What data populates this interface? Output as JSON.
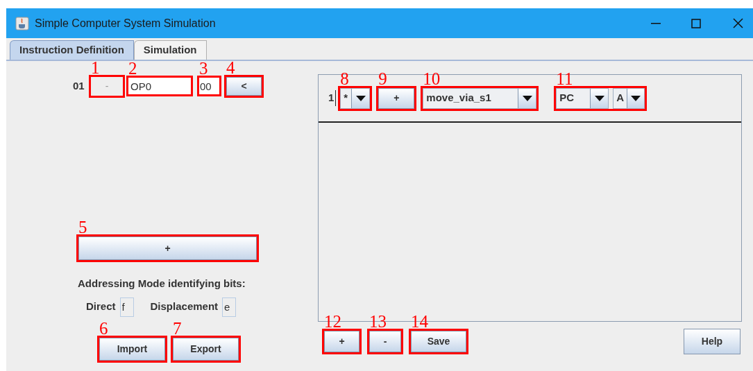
{
  "window": {
    "title": "Simple Computer System Simulation"
  },
  "tabs": [
    {
      "label": "Instruction Definition",
      "selected": true
    },
    {
      "label": "Simulation",
      "selected": false
    }
  ],
  "instruction_row": {
    "number": "01",
    "remove_button": {
      "label": "-",
      "disabled": true,
      "callout": "1"
    },
    "name_field": {
      "value": "OP0",
      "callout": "2"
    },
    "code_field": {
      "value": "00",
      "callout": "3"
    },
    "collapse_button": {
      "label": "<",
      "callout": "4"
    }
  },
  "add_button": {
    "label": "+",
    "callout": "5"
  },
  "addressing": {
    "heading": "Addressing Mode identifying bits:",
    "modes": [
      {
        "label": "Direct",
        "value": "f"
      },
      {
        "label": "Displacement",
        "value": "e"
      }
    ]
  },
  "left_buttons": [
    {
      "label": "Import",
      "callout": "6"
    },
    {
      "label": "Export",
      "callout": "7"
    }
  ],
  "step_row": {
    "number": "1",
    "flag_combo": {
      "value": "*",
      "callout": "8"
    },
    "add_button": {
      "label": "+",
      "callout": "9"
    },
    "operation_combo": {
      "value": "move_via_s1",
      "callout": "10"
    },
    "operand_combos": {
      "callout": "11",
      "items": [
        {
          "value": "PC"
        },
        {
          "value": "A"
        }
      ]
    }
  },
  "bottom_buttons": [
    {
      "label": "+",
      "callout": "12"
    },
    {
      "label": "-",
      "callout": "13"
    },
    {
      "label": "Save",
      "callout": "14"
    }
  ],
  "help_button": {
    "label": "Help"
  }
}
